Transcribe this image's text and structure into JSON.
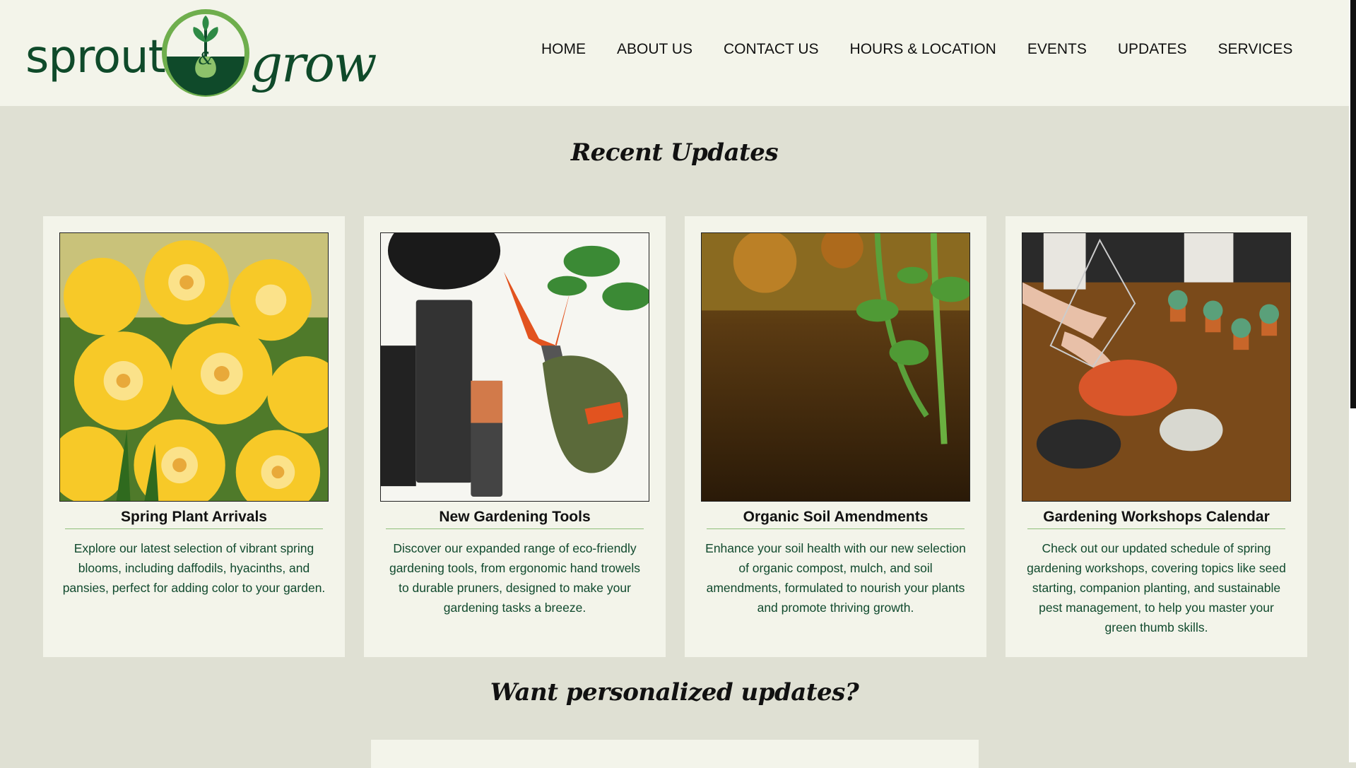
{
  "logo": {
    "left_word": "sprout",
    "ampersand": "&",
    "right_word": "grow"
  },
  "nav": {
    "items": [
      {
        "label": "HOME"
      },
      {
        "label": "ABOUT US"
      },
      {
        "label": "CONTACT US"
      },
      {
        "label": "HOURS & LOCATION"
      },
      {
        "label": "EVENTS"
      },
      {
        "label": "UPDATES"
      },
      {
        "label": "SERVICES"
      }
    ]
  },
  "updates": {
    "heading": "Recent Updates",
    "cards": [
      {
        "title": "Spring Plant Arrivals",
        "description": "Explore our latest selection of vibrant spring blooms, including daffodils, hyacinths, and pansies, perfect for adding color to your garden.",
        "image": "daffodils-photo"
      },
      {
        "title": "New Gardening Tools",
        "description": "Discover our expanded range of eco-friendly gardening tools, from ergonomic hand trowels to durable pruners, designed to make your gardening tasks a breeze.",
        "image": "garden-tools-photo"
      },
      {
        "title": "Organic Soil Amendments",
        "description": "Enhance your soil health with our new selection of organic compost, mulch, and soil amendments, formulated to nourish your plants and promote thriving growth.",
        "image": "soil-seedling-photo"
      },
      {
        "title": "Gardening Workshops Calendar",
        "description": "Check out our updated schedule of spring gardening workshops, covering topics like seed starting, companion planting, and sustainable pest management, to help you master your green thumb skills.",
        "image": "terrarium-workshop-photo"
      }
    ]
  },
  "personalized": {
    "heading": "Want personalized updates?"
  },
  "colors": {
    "header_bg": "#f3f4ea",
    "page_bg": "#dfe0d3",
    "brand_green": "#0f4a2a",
    "accent_green": "#8fbf7a"
  }
}
